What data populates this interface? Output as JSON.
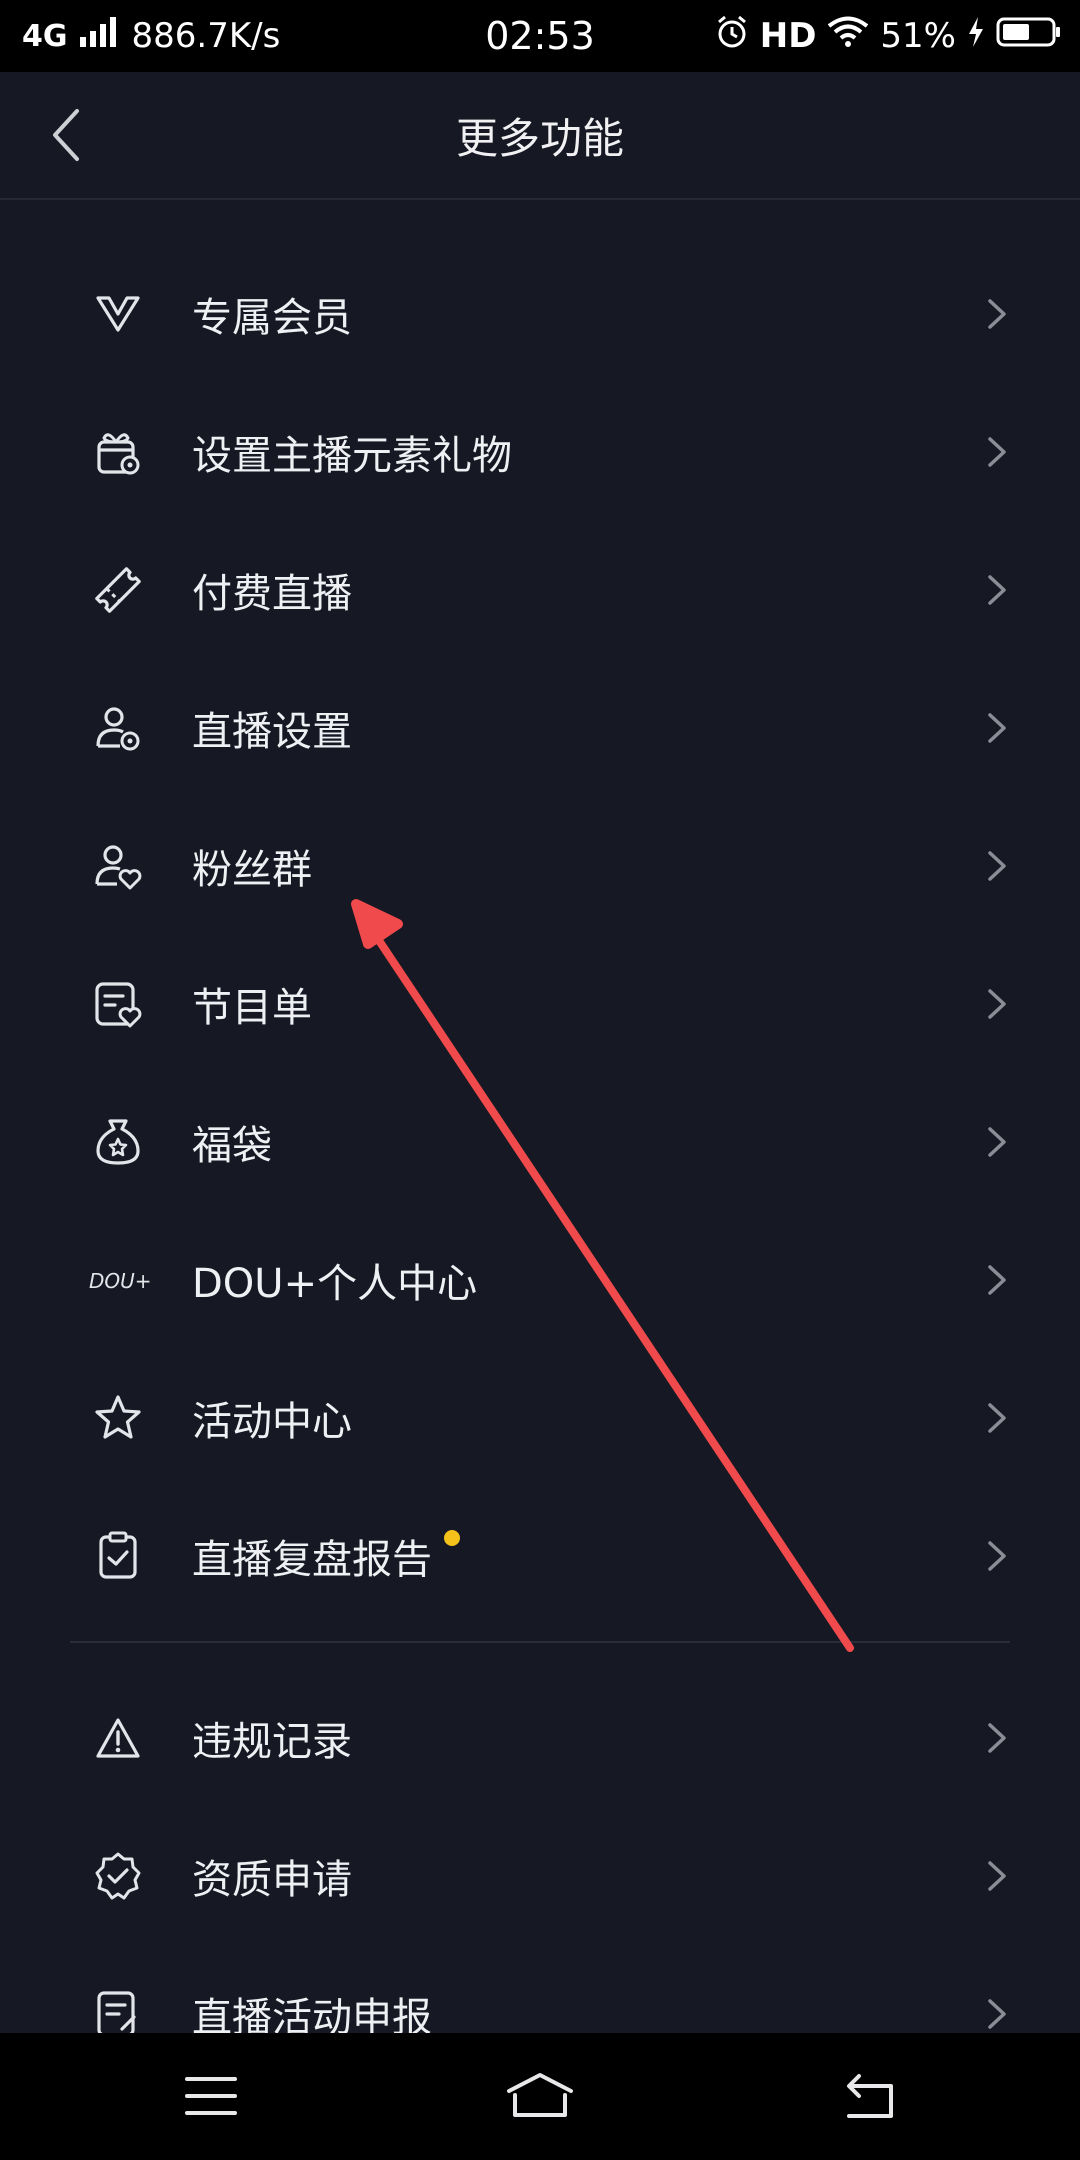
{
  "status_bar": {
    "network": "4G",
    "speed": "886.7K/s",
    "time": "02:53",
    "hd": "HD",
    "battery": "51%",
    "icons": [
      "signal-icon",
      "alarm-icon",
      "wifi-icon",
      "charging-icon",
      "battery-icon"
    ]
  },
  "header": {
    "title": "更多功能",
    "back_icon": "chevron-left-icon"
  },
  "menu_items": [
    {
      "label": "专属会员",
      "icon": "vip-icon"
    },
    {
      "label": "设置主播元素礼物",
      "icon": "gift-settings-icon"
    },
    {
      "label": "付费直播",
      "icon": "ticket-icon"
    },
    {
      "label": "直播设置",
      "icon": "user-settings-icon"
    },
    {
      "label": "粉丝群",
      "icon": "fan-group-icon"
    },
    {
      "label": "节目单",
      "icon": "program-list-icon"
    },
    {
      "label": "福袋",
      "icon": "lucky-bag-icon"
    },
    {
      "label": "DOU+个人中心",
      "icon": "dou-plus-icon",
      "icon_text": "DOU+"
    },
    {
      "label": "活动中心",
      "icon": "star-icon"
    },
    {
      "label": "直播复盘报告",
      "icon": "clipboard-check-icon",
      "badge": "new-dot"
    }
  ],
  "menu_items_2": [
    {
      "label": "违规记录",
      "icon": "warning-icon"
    },
    {
      "label": "资质申请",
      "icon": "verified-badge-icon"
    },
    {
      "label": "直播活动申报",
      "icon": "report-form-icon"
    }
  ],
  "colors": {
    "background": "#161823",
    "text": "#eef0f3",
    "chevron": "#8a8c96",
    "badge": "#f5c21b",
    "annotation_arrow": "#f04a4c"
  },
  "nav_bar": {
    "icons": [
      "menu-icon",
      "home-icon",
      "back-icon"
    ]
  }
}
